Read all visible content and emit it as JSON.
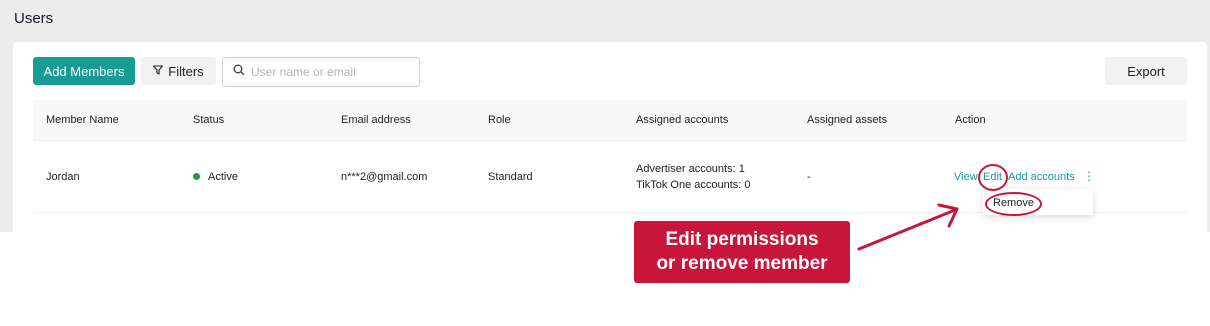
{
  "page": {
    "title": "Users"
  },
  "toolbar": {
    "add_members_label": "Add Members",
    "filters_label": "Filters",
    "search_placeholder": "User name or email",
    "export_label": "Export"
  },
  "table": {
    "headers": [
      "Member Name",
      "Status",
      "Email address",
      "Role",
      "Assigned accounts",
      "Assigned assets",
      "Action"
    ],
    "rows": [
      {
        "member_name": "Jordan",
        "status": "Active",
        "email": "n***2@gmail.com",
        "role": "Standard",
        "assigned_accounts": [
          "Advertiser accounts: 1",
          "TikTok One accounts: 0"
        ],
        "assigned_assets": "-",
        "actions": {
          "view": "View",
          "edit": "Edit",
          "add_accounts": "Add accounts",
          "more": "⋮"
        }
      }
    ]
  },
  "dropdown": {
    "items": [
      "Remove"
    ]
  },
  "annotation": {
    "line1": "Edit permissions",
    "line2": "or remove member"
  },
  "colors": {
    "accent": "#179c94",
    "status_active": "#1a9e3f",
    "annotation": "#c8163a"
  },
  "icons": {
    "filter": "filter-icon",
    "search": "search-icon",
    "more": "more-vertical-icon"
  }
}
